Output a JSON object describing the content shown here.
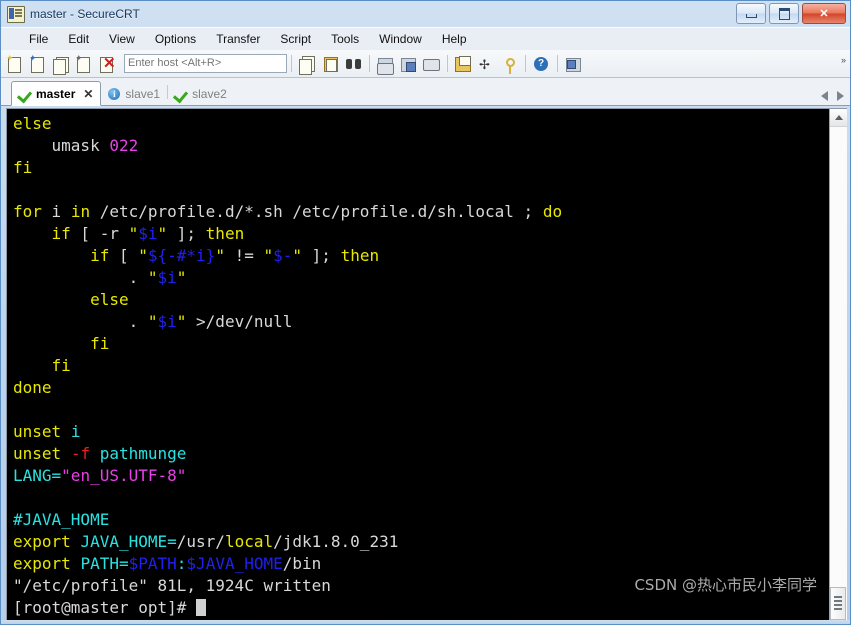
{
  "window": {
    "title": "master - SecureCRT",
    "icon": "securecrt-icon",
    "buttons": {
      "minimize": "minimize-button",
      "maximize": "maximize-button",
      "close_label": "✕"
    }
  },
  "menubar": {
    "items": [
      "File",
      "Edit",
      "View",
      "Options",
      "Transfer",
      "Script",
      "Tools",
      "Window",
      "Help"
    ]
  },
  "toolbar": {
    "host_placeholder": "Enter host <Alt+R>",
    "host_value": "",
    "icons": [
      "new-session-icon",
      "connect-session-icon",
      "clone-session-icon",
      "connect-sftp-icon",
      "disconnect-icon",
      "copy-icon",
      "paste-icon",
      "find-icon",
      "print-screen-icon",
      "log-session-icon",
      "print-icon",
      "session-options-icon",
      "toggle-chat-icon",
      "key-manager-icon",
      "help-icon",
      "tile-windows-icon"
    ],
    "overflow_label": "»"
  },
  "tabs": [
    {
      "label": "master",
      "status_icon": "green-check-icon",
      "active": true,
      "closable": true,
      "close_label": "✕"
    },
    {
      "label": "slave1",
      "status_icon": "blue-info-icon",
      "active": false,
      "closable": false,
      "close_label": ""
    },
    {
      "label": "slave2",
      "status_icon": "green-check-icon",
      "active": false,
      "closable": false,
      "close_label": ""
    }
  ],
  "tab_nav": {
    "prev": "tab-scroll-left-icon",
    "next": "tab-scroll-right-icon"
  },
  "terminal": {
    "colors": {
      "background": "#000000",
      "foreground": "#d8d8d8",
      "yellow": "#e8e800",
      "magenta": "#e840e8",
      "blue": "#2020ee",
      "cyan": "#2ae2e2",
      "red": "#e82020"
    },
    "lines": [
      [
        {
          "t": "else",
          "c": "y"
        }
      ],
      [
        {
          "t": "    umask ",
          "c": "w"
        },
        {
          "t": "022",
          "c": "m"
        }
      ],
      [
        {
          "t": "fi",
          "c": "y"
        }
      ],
      [],
      [
        {
          "t": "for",
          "c": "y"
        },
        {
          "t": " i ",
          "c": "w"
        },
        {
          "t": "in",
          "c": "y"
        },
        {
          "t": " /etc/profile.d/*.sh /etc/profile.d/sh.local ; ",
          "c": "w"
        },
        {
          "t": "do",
          "c": "y"
        }
      ],
      [
        {
          "t": "    ",
          "c": "w"
        },
        {
          "t": "if",
          "c": "y"
        },
        {
          "t": " [ -r ",
          "c": "w"
        },
        {
          "t": "\"",
          "c": "y"
        },
        {
          "t": "$i",
          "c": "b"
        },
        {
          "t": "\"",
          "c": "y"
        },
        {
          "t": " ]; ",
          "c": "w"
        },
        {
          "t": "then",
          "c": "y"
        }
      ],
      [
        {
          "t": "        ",
          "c": "w"
        },
        {
          "t": "if",
          "c": "y"
        },
        {
          "t": " [ ",
          "c": "w"
        },
        {
          "t": "\"",
          "c": "y"
        },
        {
          "t": "${-#*i}",
          "c": "b"
        },
        {
          "t": "\"",
          "c": "y"
        },
        {
          "t": " != ",
          "c": "w"
        },
        {
          "t": "\"",
          "c": "y"
        },
        {
          "t": "$-",
          "c": "b"
        },
        {
          "t": "\"",
          "c": "y"
        },
        {
          "t": " ]; ",
          "c": "w"
        },
        {
          "t": "then",
          "c": "y"
        }
      ],
      [
        {
          "t": "            . ",
          "c": "w"
        },
        {
          "t": "\"",
          "c": "y"
        },
        {
          "t": "$i",
          "c": "b"
        },
        {
          "t": "\"",
          "c": "y"
        }
      ],
      [
        {
          "t": "        ",
          "c": "w"
        },
        {
          "t": "else",
          "c": "y"
        }
      ],
      [
        {
          "t": "            . ",
          "c": "w"
        },
        {
          "t": "\"",
          "c": "y"
        },
        {
          "t": "$i",
          "c": "b"
        },
        {
          "t": "\"",
          "c": "y"
        },
        {
          "t": " >/dev/null",
          "c": "w"
        }
      ],
      [
        {
          "t": "        ",
          "c": "w"
        },
        {
          "t": "fi",
          "c": "y"
        }
      ],
      [
        {
          "t": "    ",
          "c": "w"
        },
        {
          "t": "fi",
          "c": "y"
        }
      ],
      [
        {
          "t": "done",
          "c": "y"
        }
      ],
      [],
      [
        {
          "t": "unset",
          "c": "y"
        },
        {
          "t": " ",
          "c": "w"
        },
        {
          "t": "i",
          "c": "c"
        }
      ],
      [
        {
          "t": "unset",
          "c": "y"
        },
        {
          "t": " ",
          "c": "w"
        },
        {
          "t": "-f",
          "c": "r"
        },
        {
          "t": " ",
          "c": "w"
        },
        {
          "t": "pathmunge",
          "c": "c"
        }
      ],
      [
        {
          "t": "LANG=",
          "c": "c"
        },
        {
          "t": "\"en_US.UTF-8\"",
          "c": "m"
        }
      ],
      [],
      [
        {
          "t": "#JAVA_HOME",
          "c": "c"
        }
      ],
      [
        {
          "t": "export",
          "c": "y"
        },
        {
          "t": " ",
          "c": "w"
        },
        {
          "t": "JAVA_HOME=",
          "c": "c"
        },
        {
          "t": "/usr/",
          "c": "w"
        },
        {
          "t": "local",
          "c": "y"
        },
        {
          "t": "/jdk1.8.0_231",
          "c": "w"
        }
      ],
      [
        {
          "t": "export",
          "c": "y"
        },
        {
          "t": " ",
          "c": "w"
        },
        {
          "t": "PATH=",
          "c": "c"
        },
        {
          "t": "$PATH",
          "c": "b"
        },
        {
          "t": ":",
          "c": "c"
        },
        {
          "t": "$JAVA_HOME",
          "c": "b"
        },
        {
          "t": "/bin",
          "c": "w"
        }
      ],
      [
        {
          "t": "\"/etc/profile\" 81L, 1924C written",
          "c": "w"
        }
      ],
      [
        {
          "t": "[root@master opt]# ",
          "c": "w"
        },
        {
          "t": "",
          "c": "cursor"
        }
      ]
    ],
    "watermark": "CSDN @热心市民小李同学",
    "scrollbar": {
      "up_arrow": "scroll-up-icon",
      "thumb": "scroll-thumb"
    }
  }
}
